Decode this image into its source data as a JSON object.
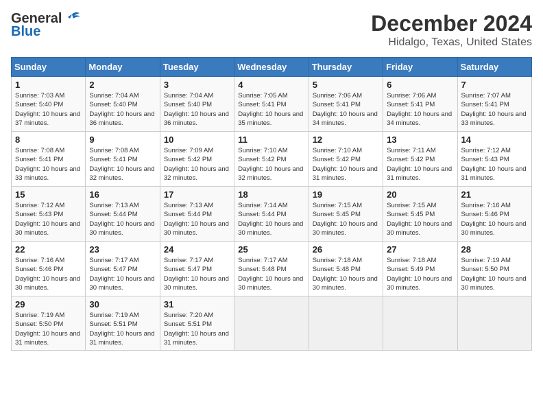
{
  "header": {
    "logo_general": "General",
    "logo_blue": "Blue",
    "month": "December 2024",
    "location": "Hidalgo, Texas, United States"
  },
  "weekdays": [
    "Sunday",
    "Monday",
    "Tuesday",
    "Wednesday",
    "Thursday",
    "Friday",
    "Saturday"
  ],
  "weeks": [
    [
      {
        "day": "1",
        "sunrise": "7:03 AM",
        "sunset": "5:40 PM",
        "daylight": "10 hours and 37 minutes."
      },
      {
        "day": "2",
        "sunrise": "7:04 AM",
        "sunset": "5:40 PM",
        "daylight": "10 hours and 36 minutes."
      },
      {
        "day": "3",
        "sunrise": "7:04 AM",
        "sunset": "5:40 PM",
        "daylight": "10 hours and 36 minutes."
      },
      {
        "day": "4",
        "sunrise": "7:05 AM",
        "sunset": "5:41 PM",
        "daylight": "10 hours and 35 minutes."
      },
      {
        "day": "5",
        "sunrise": "7:06 AM",
        "sunset": "5:41 PM",
        "daylight": "10 hours and 34 minutes."
      },
      {
        "day": "6",
        "sunrise": "7:06 AM",
        "sunset": "5:41 PM",
        "daylight": "10 hours and 34 minutes."
      },
      {
        "day": "7",
        "sunrise": "7:07 AM",
        "sunset": "5:41 PM",
        "daylight": "10 hours and 33 minutes."
      }
    ],
    [
      {
        "day": "8",
        "sunrise": "7:08 AM",
        "sunset": "5:41 PM",
        "daylight": "10 hours and 33 minutes."
      },
      {
        "day": "9",
        "sunrise": "7:08 AM",
        "sunset": "5:41 PM",
        "daylight": "10 hours and 32 minutes."
      },
      {
        "day": "10",
        "sunrise": "7:09 AM",
        "sunset": "5:42 PM",
        "daylight": "10 hours and 32 minutes."
      },
      {
        "day": "11",
        "sunrise": "7:10 AM",
        "sunset": "5:42 PM",
        "daylight": "10 hours and 32 minutes."
      },
      {
        "day": "12",
        "sunrise": "7:10 AM",
        "sunset": "5:42 PM",
        "daylight": "10 hours and 31 minutes."
      },
      {
        "day": "13",
        "sunrise": "7:11 AM",
        "sunset": "5:42 PM",
        "daylight": "10 hours and 31 minutes."
      },
      {
        "day": "14",
        "sunrise": "7:12 AM",
        "sunset": "5:43 PM",
        "daylight": "10 hours and 31 minutes."
      }
    ],
    [
      {
        "day": "15",
        "sunrise": "7:12 AM",
        "sunset": "5:43 PM",
        "daylight": "10 hours and 30 minutes."
      },
      {
        "day": "16",
        "sunrise": "7:13 AM",
        "sunset": "5:44 PM",
        "daylight": "10 hours and 30 minutes."
      },
      {
        "day": "17",
        "sunrise": "7:13 AM",
        "sunset": "5:44 PM",
        "daylight": "10 hours and 30 minutes."
      },
      {
        "day": "18",
        "sunrise": "7:14 AM",
        "sunset": "5:44 PM",
        "daylight": "10 hours and 30 minutes."
      },
      {
        "day": "19",
        "sunrise": "7:15 AM",
        "sunset": "5:45 PM",
        "daylight": "10 hours and 30 minutes."
      },
      {
        "day": "20",
        "sunrise": "7:15 AM",
        "sunset": "5:45 PM",
        "daylight": "10 hours and 30 minutes."
      },
      {
        "day": "21",
        "sunrise": "7:16 AM",
        "sunset": "5:46 PM",
        "daylight": "10 hours and 30 minutes."
      }
    ],
    [
      {
        "day": "22",
        "sunrise": "7:16 AM",
        "sunset": "5:46 PM",
        "daylight": "10 hours and 30 minutes."
      },
      {
        "day": "23",
        "sunrise": "7:17 AM",
        "sunset": "5:47 PM",
        "daylight": "10 hours and 30 minutes."
      },
      {
        "day": "24",
        "sunrise": "7:17 AM",
        "sunset": "5:47 PM",
        "daylight": "10 hours and 30 minutes."
      },
      {
        "day": "25",
        "sunrise": "7:17 AM",
        "sunset": "5:48 PM",
        "daylight": "10 hours and 30 minutes."
      },
      {
        "day": "26",
        "sunrise": "7:18 AM",
        "sunset": "5:48 PM",
        "daylight": "10 hours and 30 minutes."
      },
      {
        "day": "27",
        "sunrise": "7:18 AM",
        "sunset": "5:49 PM",
        "daylight": "10 hours and 30 minutes."
      },
      {
        "day": "28",
        "sunrise": "7:19 AM",
        "sunset": "5:50 PM",
        "daylight": "10 hours and 30 minutes."
      }
    ],
    [
      {
        "day": "29",
        "sunrise": "7:19 AM",
        "sunset": "5:50 PM",
        "daylight": "10 hours and 31 minutes."
      },
      {
        "day": "30",
        "sunrise": "7:19 AM",
        "sunset": "5:51 PM",
        "daylight": "10 hours and 31 minutes."
      },
      {
        "day": "31",
        "sunrise": "7:20 AM",
        "sunset": "5:51 PM",
        "daylight": "10 hours and 31 minutes."
      },
      null,
      null,
      null,
      null
    ]
  ],
  "labels": {
    "sunrise": "Sunrise:",
    "sunset": "Sunset:",
    "daylight": "Daylight:"
  }
}
